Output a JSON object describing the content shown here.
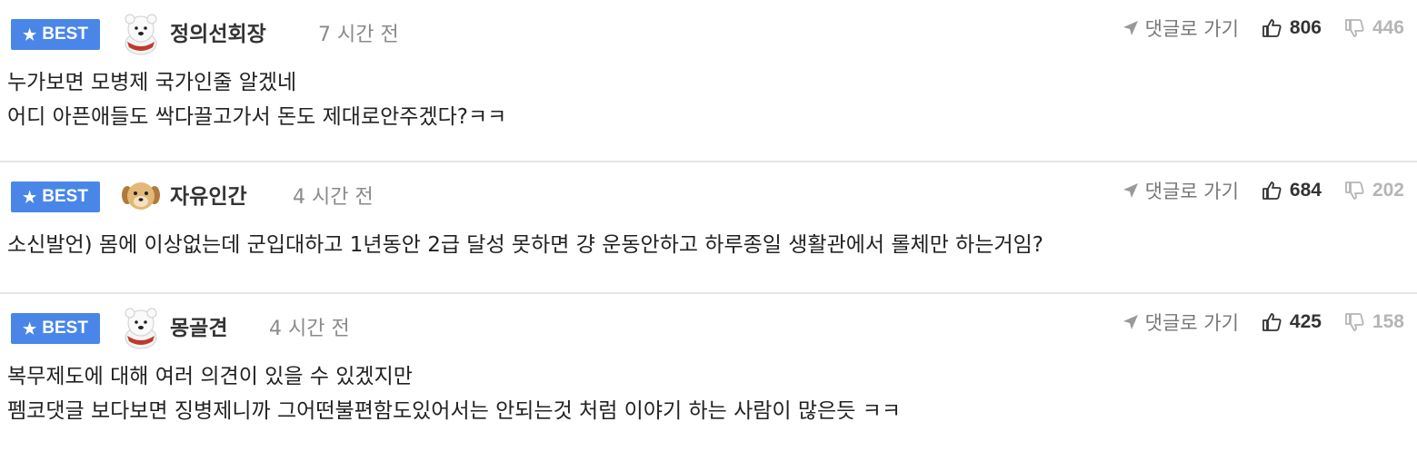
{
  "common": {
    "badge_label": "BEST",
    "reply_label": "댓글로 가기"
  },
  "comments": [
    {
      "avatar": "polar-bear-avatar",
      "username": "정의선회장",
      "time": "7 시간 전",
      "upvotes": "806",
      "downvotes": "446",
      "lines": [
        "누가보면 모병제 국가인줄 알겠네",
        "어디 아픈애들도 싹다끌고가서 돈도 제대로안주겠다?ㅋㅋ"
      ]
    },
    {
      "avatar": "puppy-avatar",
      "username": "자유인간",
      "time": "4 시간 전",
      "upvotes": "684",
      "downvotes": "202",
      "lines": [
        "소신발언) 몸에 이상없는데 군입대하고 1년동안 2급 달성 못하면 걍 운동안하고 하루종일 생활관에서 롤체만 하는거임?"
      ]
    },
    {
      "avatar": "polar-bear-avatar",
      "username": "몽골견",
      "time": "4 시간 전",
      "upvotes": "425",
      "downvotes": "158",
      "lines": [
        "복무제도에 대해 여러 의견이 있을 수 있겠지만",
        "펨코댓글 보다보면 징병제니까 그어떤불편함도있어서는 안되는것 처럼 이야기 하는 사람이 많은듯 ㅋㅋ"
      ]
    }
  ],
  "colors": {
    "badge": "#4a86e8",
    "divider": "#e6e6e6",
    "upvote_text": "#333333",
    "downvote_text": "#b5b5b5",
    "muted_text": "#8a8a8a"
  },
  "icons": {
    "badge_icon": "star-icon",
    "reply_icon": "send-arrow-icon",
    "upvote_icon": "thumbs-up-icon",
    "downvote_icon": "thumbs-down-icon"
  }
}
